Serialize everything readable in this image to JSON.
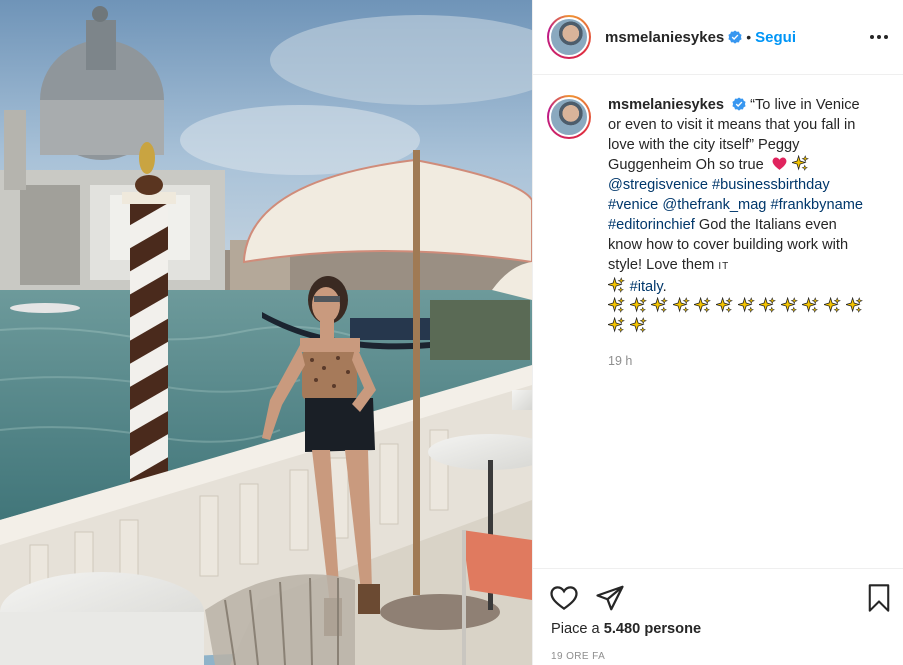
{
  "post": {
    "photo_alt": "",
    "colors": {
      "link": "#00376b",
      "follow": "#0095f6",
      "heart": "#e0245e",
      "muted": "#8e8e8e",
      "verified": "#3897f0"
    }
  },
  "header": {
    "username": "msmelaniesykes",
    "separator": "•",
    "follow_label": "Segui",
    "more_icon": "more-horizontal-icon"
  },
  "caption": {
    "username": "msmelaniesykes",
    "text_1": "“To live in Venice or even to visit it means that you fall in love with the city itself” Peggy Guggenheim Oh so true",
    "heart_emoji": "❤️",
    "mention_1": "@stregisvenice",
    "hashtag_1": "#businessbirthday",
    "hashtag_2": "#venice",
    "mention_2": "@thefrank_mag",
    "hashtag_3": "#frankbyname",
    "hashtag_4": "#editorinchief",
    "text_2": "God the Italians even know how to cover building work with style! Love them",
    "flag_text": "IT",
    "hashtag_5": "#italy",
    "text_3": ".",
    "relative_time": "19 h"
  },
  "actions": {
    "like_icon": "heart-icon",
    "share_icon": "send-icon",
    "save_icon": "bookmark-icon",
    "likes_prefix": "Piace a",
    "likes_count": "5.480 persone",
    "post_time": "19 ORE FA"
  }
}
